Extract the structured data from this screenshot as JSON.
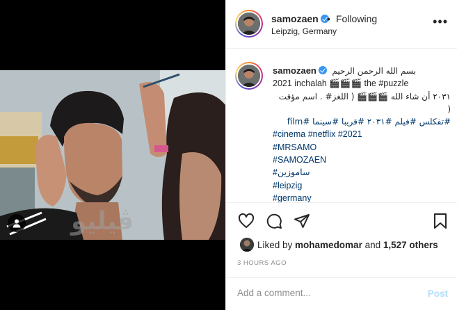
{
  "post": {
    "username": "samozaen",
    "follow_status": "Following",
    "location": "Leipzig, Germany",
    "watermark": "ڤيليو"
  },
  "caption": {
    "username": "samozaen",
    "lines": [
      "بسم الله الرحمن الرحيم",
      "2021 inchalah 🎬🎬🎬 the #puzzle",
      "٢٠٣١ أن شاء الله 🎬🎬🎬 ( اللغز# . اسم مؤقت",
      "(",
      "#تفكلس #فيلم #٢٠٣١ #قريبا #سينما #film",
      "#cinema #netflix #2021",
      "#MRSAMO",
      "#SAMOZAEN",
      "#سامو​زين",
      "#leipzig",
      "#germany"
    ]
  },
  "likes": {
    "prefix": "Liked by ",
    "user": "mohamedomar",
    "middle": " and ",
    "count": "1,527 others"
  },
  "timestamp": "3 HOURS AGO",
  "comment": {
    "placeholder": "Add a comment...",
    "post_label": "Post"
  },
  "icons": {
    "more": "more-options-icon",
    "like": "heart-icon",
    "comment": "comment-icon",
    "share": "share-icon",
    "save": "bookmark-icon",
    "user_tag": "user-tag-icon",
    "verified": "verified-badge-icon"
  },
  "colors": {
    "link": "#00376b",
    "verified": "#3897f0",
    "post_disabled": "#b2dffc",
    "muted": "#8e8e8e"
  }
}
